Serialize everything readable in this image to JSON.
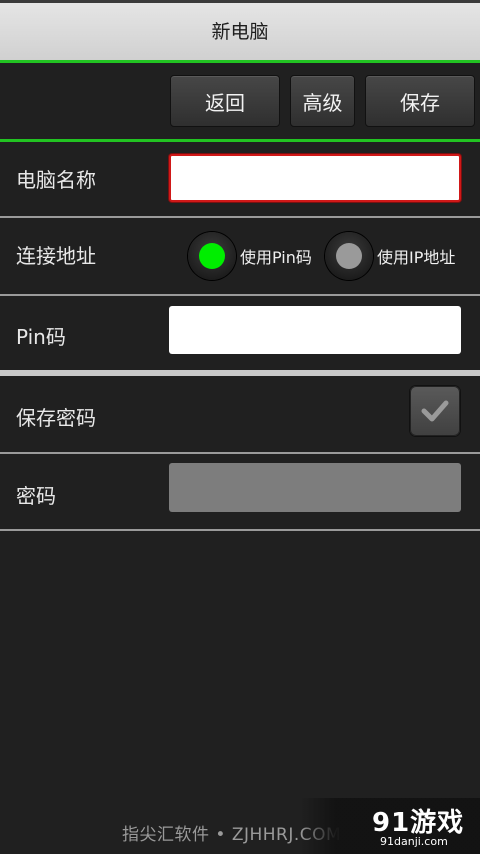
{
  "header": {
    "title": "新电脑"
  },
  "toolbar": {
    "back_label": "返回",
    "advanced_label": "高级",
    "save_label": "保存"
  },
  "form": {
    "computer_name": {
      "label": "电脑名称",
      "value": ""
    },
    "connection": {
      "label": "连接地址",
      "options": [
        {
          "label": "使用Pin码",
          "selected": true
        },
        {
          "label": "使用IP地址",
          "selected": false
        }
      ]
    },
    "pin": {
      "label": "Pin码",
      "value": ""
    },
    "save_password": {
      "label": "保存密码",
      "checked": true
    },
    "password": {
      "label": "密码",
      "value": ""
    }
  },
  "watermark": {
    "text": "指尖汇软件 • ZJHHRJ.COM",
    "brand": "91游戏",
    "brand_url": "91danji.com"
  },
  "colors": {
    "accent_green": "#22c322",
    "radio_selected": "#00ee00",
    "radio_unselected": "#9a9a9a",
    "focus_red": "#d01818"
  }
}
